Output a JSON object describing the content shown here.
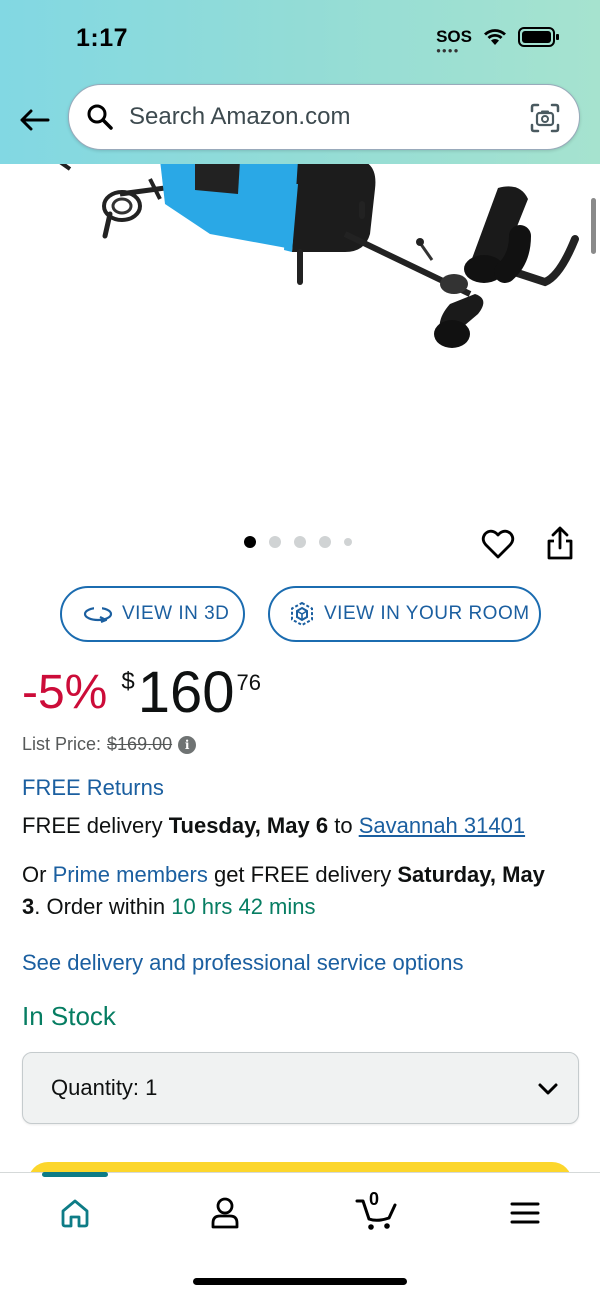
{
  "status_bar": {
    "time": "1:17",
    "sos": "SOS"
  },
  "search": {
    "placeholder": "Search Amazon.com"
  },
  "image_carousel": {
    "total_images": 5,
    "active_index": 0
  },
  "buttons": {
    "view_3d": "VIEW IN 3D",
    "view_room": "VIEW IN YOUR ROOM"
  },
  "price": {
    "discount": "-5%",
    "currency": "$",
    "whole": "160",
    "fraction": "76",
    "list_price_label": "List Price:",
    "list_price_value": "$169.00"
  },
  "delivery": {
    "free_returns": "FREE Returns",
    "free_delivery_prefix": "FREE delivery",
    "delivery_date": "Tuesday, May 6",
    "to": "to",
    "location": "Savannah 31401",
    "or": "Or",
    "prime_link": "Prime members",
    "prime_text": "get FREE delivery",
    "prime_date_line1": "Saturday, May",
    "prime_date_line2": "3",
    "order_within": ". Order within",
    "countdown": "10 hrs 42 mins",
    "service_options": "See delivery and professional service options"
  },
  "stock": {
    "status": "In Stock"
  },
  "quantity": {
    "label": "Quantity:",
    "value": "1"
  },
  "cart": {
    "count": "0"
  },
  "colors": {
    "accent_teal": "#0e7c86",
    "price_red": "#cc0c39",
    "link_blue": "#1b5fa0",
    "stock_green": "#067d62",
    "cta_yellow": "#fcd62c"
  }
}
